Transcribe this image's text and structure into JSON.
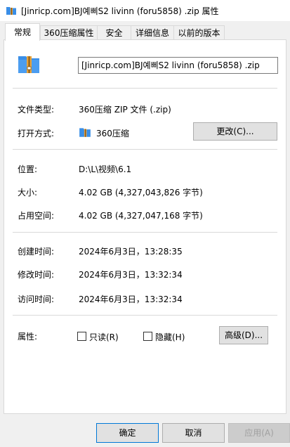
{
  "window": {
    "title": "[Jinricp.com]BJ예삐S2 livinn  (foru5858) .zip 属性"
  },
  "tabs": [
    {
      "label": "常规",
      "active": true
    },
    {
      "label": "360压缩属性",
      "active": false
    },
    {
      "label": "安全",
      "active": false
    },
    {
      "label": "详细信息",
      "active": false
    },
    {
      "label": "以前的版本",
      "active": false
    }
  ],
  "file": {
    "name": "[Jinricp.com]BJ예삐S2 livinn  (foru5858) .zip",
    "icon": "archive-icon",
    "type_label": "文件类型:",
    "type_value": "360压缩 ZIP 文件 (.zip)",
    "open_label": "打开方式:",
    "open_value": "360压缩",
    "change_button": "更改(C)...",
    "location_label": "位置:",
    "location_value": "D:\\L\\视频\\6.1",
    "size_label": "大小:",
    "size_value": "4.02 GB (4,327,043,826 字节)",
    "disk_size_label": "占用空间:",
    "disk_size_value": "4.02 GB (4,327,047,168 字节)",
    "created_label": "创建时间:",
    "created_value": "2024年6月3日，13:28:35",
    "modified_label": "修改时间:",
    "modified_value": "2024年6月3日，13:32:34",
    "accessed_label": "访问时间:",
    "accessed_value": "2024年6月3日，13:32:34",
    "attributes_label": "属性:",
    "readonly_label": "只读(R)",
    "readonly_checked": false,
    "hidden_label": "隐藏(H)",
    "hidden_checked": false,
    "advanced_button": "高级(D)..."
  },
  "footer": {
    "ok": "确定",
    "cancel": "取消",
    "apply": "应用(A)"
  },
  "colors": {
    "accent": "#0078d7",
    "folder_blue": "#3a8ee6",
    "archive_orange": "#e8a33b"
  }
}
